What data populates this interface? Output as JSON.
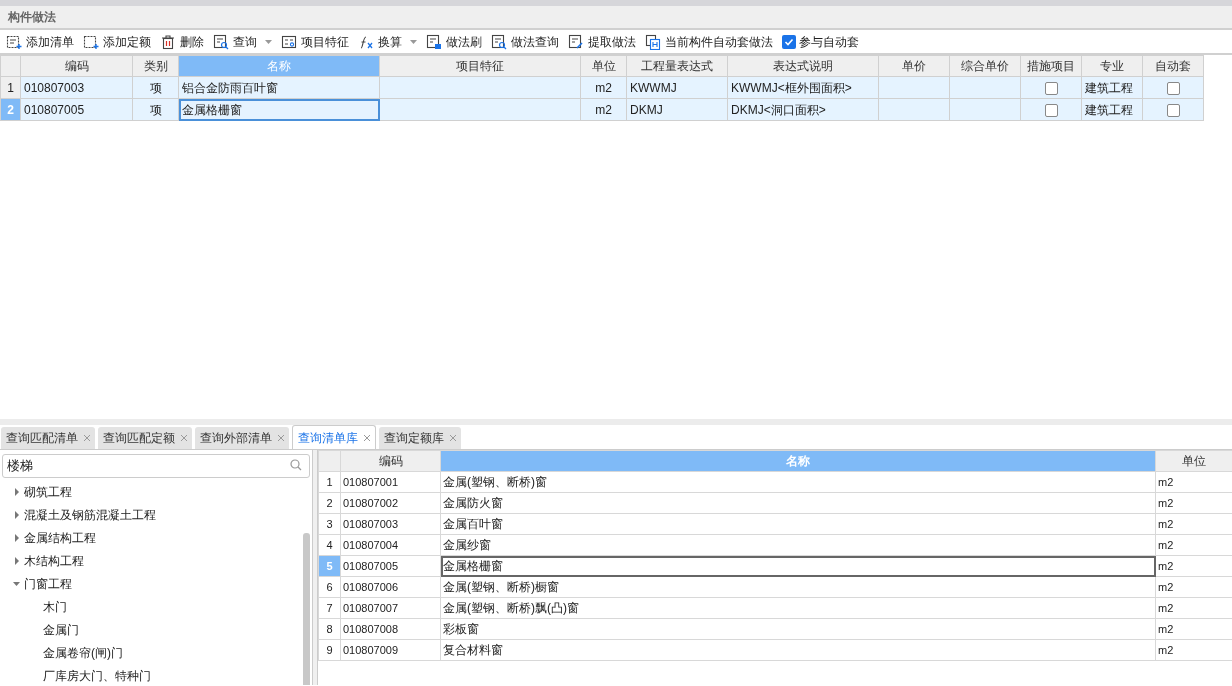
{
  "panel_title": "构件做法",
  "toolbar": [
    {
      "kind": "button",
      "label": "添加清单"
    },
    {
      "kind": "button",
      "label": "添加定额"
    },
    {
      "kind": "button",
      "label": "删除"
    },
    {
      "kind": "dropdown",
      "label": "查询"
    },
    {
      "kind": "button",
      "label": "项目特征"
    },
    {
      "kind": "dropdown",
      "label": "换算"
    },
    {
      "kind": "button",
      "label": "做法刷"
    },
    {
      "kind": "button",
      "label": "做法查询"
    },
    {
      "kind": "button",
      "label": "提取做法"
    },
    {
      "kind": "button",
      "label": "当前构件自动套做法"
    },
    {
      "kind": "checkbox",
      "label": "参与自动套",
      "checked": true
    }
  ],
  "upper_table": {
    "columns": [
      {
        "label": "编码",
        "selected": false
      },
      {
        "label": "类别",
        "selected": false
      },
      {
        "label": "名称",
        "selected": true
      },
      {
        "label": "项目特征",
        "selected": false
      },
      {
        "label": "单位",
        "selected": false
      },
      {
        "label": "工程量表达式",
        "selected": false
      },
      {
        "label": "表达式说明",
        "selected": false
      },
      {
        "label": "单价",
        "selected": false
      },
      {
        "label": "综合单价",
        "selected": false
      },
      {
        "label": "措施项目",
        "selected": false
      },
      {
        "label": "专业",
        "selected": false
      },
      {
        "label": "自动套",
        "selected": false
      }
    ],
    "rows": [
      {
        "index": "1",
        "selected": false,
        "code": "010807003",
        "type": "项",
        "name": "铝合金防雨百叶窗",
        "unit": "m2",
        "expression": "KWWMJ",
        "expression_note": "KWWMJ<框外围面积>",
        "measure": false,
        "discipline": "建筑工程",
        "auto": false
      },
      {
        "index": "2",
        "selected": true,
        "code": "010807005",
        "type": "项",
        "name": "金属格栅窗",
        "unit": "m2",
        "expression": "DKMJ",
        "expression_note": "DKMJ<洞口面积>",
        "measure": false,
        "discipline": "建筑工程",
        "auto": false
      }
    ]
  },
  "bottom_tabs": [
    {
      "label": "查询匹配清单",
      "selected": false
    },
    {
      "label": "查询匹配定额",
      "selected": false
    },
    {
      "label": "查询外部清单",
      "selected": false
    },
    {
      "label": "查询清单库",
      "selected": true
    },
    {
      "label": "查询定额库",
      "selected": false
    }
  ],
  "search": {
    "value": "楼梯"
  },
  "tree": [
    {
      "label": "砌筑工程",
      "expanded": false
    },
    {
      "label": "混凝土及钢筋混凝土工程",
      "expanded": false
    },
    {
      "label": "金属结构工程",
      "expanded": false
    },
    {
      "label": "木结构工程",
      "expanded": false
    },
    {
      "label": "门窗工程",
      "expanded": true,
      "children": [
        {
          "label": "木门"
        },
        {
          "label": "金属门"
        },
        {
          "label": "金属卷帘(闸)门"
        },
        {
          "label": "厂库房大门、特种门"
        }
      ]
    }
  ],
  "lower_table": {
    "columns": [
      {
        "label": "编码",
        "selected": false
      },
      {
        "label": "名称",
        "selected": true
      },
      {
        "label": "单位",
        "selected": false
      }
    ],
    "rows": [
      {
        "index": "1",
        "selected": false,
        "code": "010807001",
        "name": "金属(塑钢、断桥)窗",
        "unit": "m2"
      },
      {
        "index": "2",
        "selected": false,
        "code": "010807002",
        "name": "金属防火窗",
        "unit": "m2"
      },
      {
        "index": "3",
        "selected": false,
        "code": "010807003",
        "name": "金属百叶窗",
        "unit": "m2"
      },
      {
        "index": "4",
        "selected": false,
        "code": "010807004",
        "name": "金属纱窗",
        "unit": "m2"
      },
      {
        "index": "5",
        "selected": true,
        "code": "010807005",
        "name": "金属格栅窗",
        "unit": "m2"
      },
      {
        "index": "6",
        "selected": false,
        "code": "010807006",
        "name": "金属(塑钢、断桥)橱窗",
        "unit": "m2"
      },
      {
        "index": "7",
        "selected": false,
        "code": "010807007",
        "name": "金属(塑钢、断桥)飘(凸)窗",
        "unit": "m2"
      },
      {
        "index": "8",
        "selected": false,
        "code": "010807008",
        "name": "彩板窗",
        "unit": "m2"
      },
      {
        "index": "9",
        "selected": false,
        "code": "010807009",
        "name": "复合材料窗",
        "unit": "m2"
      }
    ]
  }
}
